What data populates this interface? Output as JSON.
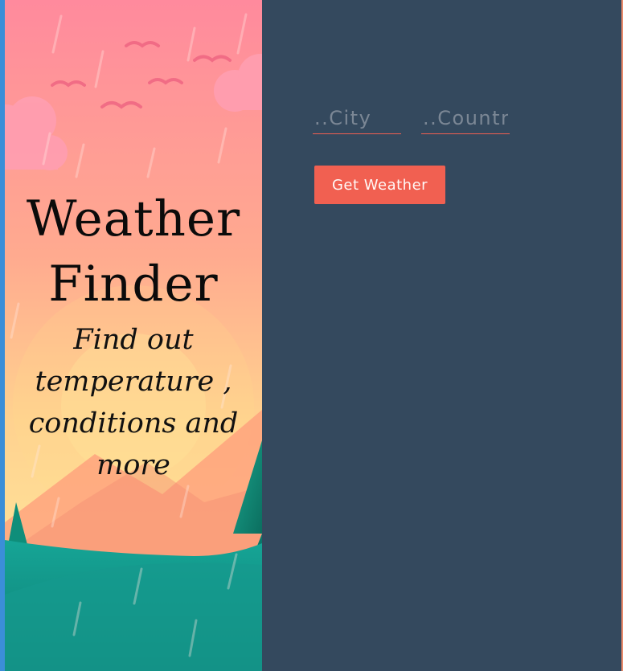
{
  "hero": {
    "title_line_1": "Weather",
    "title_line_2": "Finder",
    "subtitle_lines": [
      "Find out",
      "temperature ,",
      "conditions and",
      "more"
    ]
  },
  "form": {
    "city_placeholder": "..City",
    "country_placeholder": "..Country",
    "get_weather_label": "Get Weather"
  },
  "colors": {
    "panel_background": "#34495e",
    "accent": "#f16051",
    "hero_top": "#ff8a9d",
    "hero_middle": "#ffc58f",
    "hero_hill": "#16a596"
  },
  "icons": {
    "clouds": "cloud-icon",
    "birds": "bird-icon",
    "trees": "tree-icon"
  }
}
